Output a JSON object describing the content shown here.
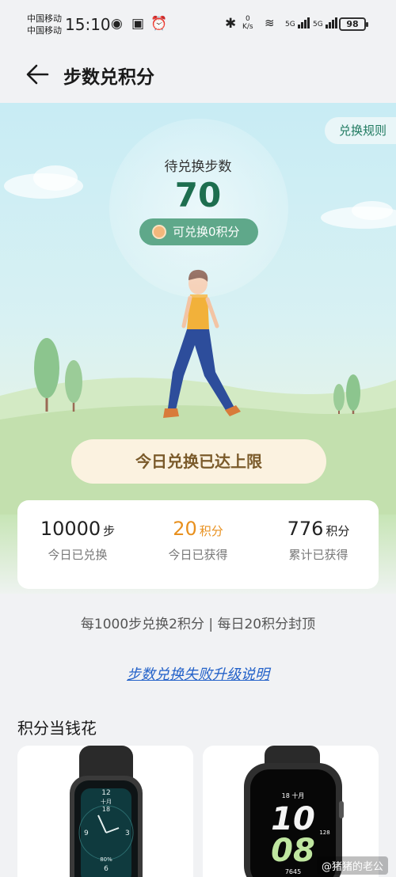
{
  "status_bar": {
    "carrier_1": "中国移动",
    "carrier_2": "中国移动",
    "time": "15:10",
    "net_speed_value": "0",
    "net_speed_unit": "K/s",
    "signal_1": "5G",
    "signal_2": "5G",
    "battery": "98"
  },
  "header": {
    "title": "步数兑积分"
  },
  "hero": {
    "rules_label": "兑换规则",
    "pending_label": "待兑换步数",
    "pending_value": "70",
    "redeemable_label": "可兑换0积分"
  },
  "limit_button": "今日兑换已达上限",
  "stats": [
    {
      "value": "10000",
      "unit": "步",
      "label": "今日已兑换",
      "highlight": false
    },
    {
      "value": "20",
      "unit": "积分",
      "label": "今日已获得",
      "highlight": true
    },
    {
      "value": "776",
      "unit": "积分",
      "label": "累计已获得",
      "highlight": false
    }
  ],
  "rule_text": "每1000步兑换2积分 | 每日20积分封顶",
  "upgrade_link": "步数兑换失败升级说明",
  "section_title": "积分当钱花",
  "products": {
    "band": {
      "time_top": "12",
      "month": "十月",
      "day": "18",
      "num_9": "9",
      "num_3": "3",
      "num_6": "6",
      "battery": "80%"
    },
    "watch": {
      "hour": "10",
      "minute": "08",
      "month": "十月",
      "day": "18",
      "steps": "7645",
      "hr": "128"
    }
  },
  "watermark": "@猪猪的老公",
  "colors": {
    "accent_green": "#1d6e4f",
    "pill_green": "#5fa88a",
    "orange": "#e8901e",
    "link_blue": "#2462c9"
  }
}
